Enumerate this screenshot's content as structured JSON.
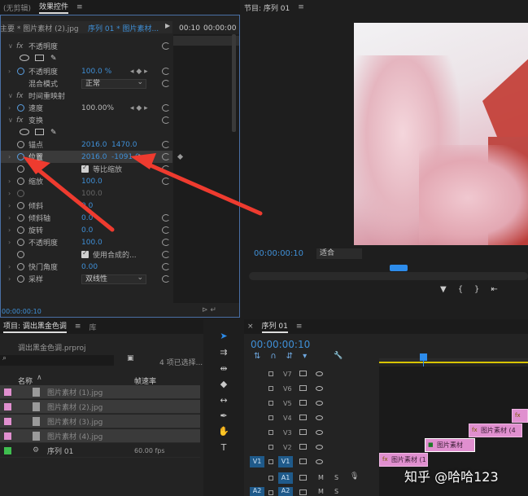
{
  "effect_controls": {
    "tabs": [
      "(无剪辑)",
      "效果控件"
    ],
    "source_label": "主要 * 图片素材 (2).jpg",
    "sequence_label": "序列 01 * 图片素材...",
    "times": [
      "00:10",
      "00:00:00"
    ],
    "bottom_time": "00:00:00:10",
    "rows": {
      "opacity_header": "不透明度",
      "opacity": {
        "label": "不透明度",
        "value": "100.0 %"
      },
      "blend": {
        "label": "混合模式",
        "value": "正常"
      },
      "time_remap": "时间重映射",
      "speed": {
        "label": "速度",
        "value": "100.00%"
      },
      "transform": "变换",
      "anchor": {
        "label": "锚点",
        "x": "2016.0",
        "y": "1470.0"
      },
      "position": {
        "label": "位置",
        "x": "2016.0",
        "y": "-1091.0"
      },
      "uniform": {
        "label": "等比缩放"
      },
      "scale": {
        "label": "缩放",
        "value": "100.0"
      },
      "scale_w": {
        "value": "100.0"
      },
      "skew": {
        "label": "倾斜",
        "value": "0.0"
      },
      "skew_axis": {
        "label": "倾斜轴",
        "value": "0.0"
      },
      "rotation": {
        "label": "旋转",
        "value": "0.0"
      },
      "opacity2": {
        "label": "不透明度",
        "value": "100.0"
      },
      "composite": {
        "label": "使用合成的..."
      },
      "shutter": {
        "label": "快门角度",
        "value": "0.00"
      },
      "sampling": {
        "label": "采样",
        "value": "双线性"
      }
    }
  },
  "program": {
    "title": "节目: 序列 01",
    "timecode": "00:00:00:10",
    "fit": "适合"
  },
  "project": {
    "tabs": [
      "项目: 调出黑金色调",
      "库"
    ],
    "file": "调出黑金色调.prproj",
    "selection": "4 项已选择...",
    "headers": {
      "name": "名称",
      "fps": "帧速率"
    },
    "items": [
      {
        "name": "图片素材 (1).jpg"
      },
      {
        "name": "图片素材 (2).jpg"
      },
      {
        "name": "图片素材 (3).jpg"
      },
      {
        "name": "图片素材 (4).jpg"
      },
      {
        "name": "序列 01",
        "fps": "60.00 fps"
      }
    ],
    "colors": {
      "pink": "#e08fcf",
      "green": "#3fbf4f"
    }
  },
  "timeline": {
    "title": "序列 01",
    "timecode": "00:00:00:10",
    "tracks": [
      "V7",
      "V6",
      "V5",
      "V4",
      "V3",
      "V2",
      "V1",
      "A1",
      "A2"
    ],
    "v1_source": "V1",
    "a1_source": "A1",
    "a2_source": "A2",
    "clips": [
      {
        "label": "图片素材 (1"
      },
      {
        "label": "图片素材"
      },
      {
        "label": "图片素材 (4"
      }
    ],
    "mute_label": "M",
    "solo_label": "S"
  },
  "watermark": "知乎 @哈哈123",
  "accent": "#2d8ceb"
}
